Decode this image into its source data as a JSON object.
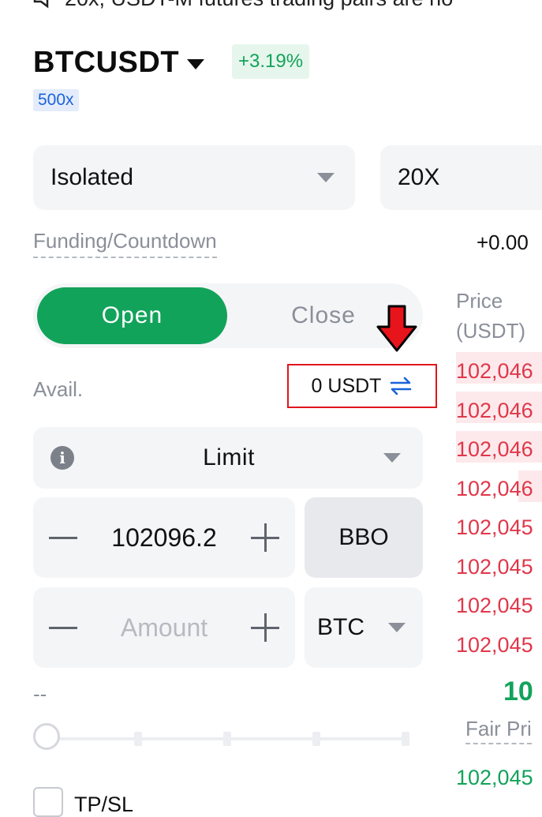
{
  "banner": {
    "text": "20x, USDT-M futures trading pairs are no"
  },
  "header": {
    "pair": "BTCUSDT",
    "change": "+3.19%",
    "max_leverage": "500x",
    "colors": {
      "up": "#12a35a",
      "accent_blue": "#1c63d8"
    }
  },
  "controls": {
    "margin_mode": "Isolated",
    "leverage": "20X"
  },
  "funding": {
    "label": "Funding/Countdown",
    "value": "+0.00"
  },
  "side_toggle": {
    "open": "Open",
    "close": "Close"
  },
  "avail": {
    "label": "Avail.",
    "value": "0 USDT"
  },
  "order_type": {
    "label": "Limit"
  },
  "price_input": {
    "value": "102096.2"
  },
  "bbo_label": "BBO",
  "amount_input": {
    "value": "",
    "placeholder": "Amount"
  },
  "unit": {
    "label": "BTC"
  },
  "estimate": "--",
  "tpsl": {
    "label": "TP/SL"
  },
  "order_book": {
    "header_line1": "Price",
    "header_line2": "(USDT)",
    "asks": [
      "102,046",
      "102,046",
      "102,046",
      "102,046",
      "102,045",
      "102,045",
      "102,045",
      "102,045"
    ],
    "last_price": "10",
    "fair_price_label": "Fair Pri",
    "bids": [
      "102,045"
    ],
    "colors": {
      "ask": "#e0374a",
      "bid": "#12a35a"
    }
  }
}
